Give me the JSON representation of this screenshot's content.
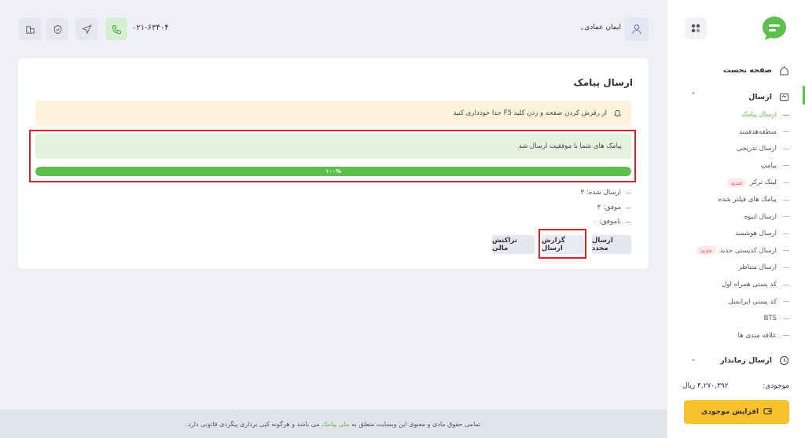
{
  "header": {
    "phone": "۰۲۱-۶۳۴۰۴",
    "user_name": "ایمان عمادی"
  },
  "sidebar": {
    "home": "صفحه نخست",
    "send_group": "ارسال",
    "sub_items": [
      {
        "label": "ارسال پیامک",
        "active": true
      },
      {
        "label": "منطقه‌هدفمند"
      },
      {
        "label": "ارسال تدریجی"
      },
      {
        "label": "پیامپ"
      },
      {
        "label": "لینک ترکر",
        "badge": "جدید"
      },
      {
        "label": "پیامک های فیلتر شده"
      },
      {
        "label": "ارسال انبوه"
      },
      {
        "label": "ارسال هوشمند"
      },
      {
        "label": "ارسال کدپستی جدید",
        "badge": "جدید"
      },
      {
        "label": "ارسال متناظر"
      },
      {
        "label": "کد پستی همراه اول"
      },
      {
        "label": "کد پستی ایرانسل"
      },
      {
        "label": "BTS"
      },
      {
        "label": "علاقه مندی ها"
      }
    ],
    "scheduled": "ارسال زماندار",
    "balance_label": "موجودی:",
    "balance_value": "۴,۲۷۰,۳۹۲ ریال",
    "topup_label": "افزایش موجودی"
  },
  "main": {
    "title": "ارسال پیامک",
    "warning": "از رفرش کردن صفحه و زدن کلید F5 جدا خودداری کنید",
    "success": "پیامک های شما با موفقیت ارسال شد",
    "progress_label": "۱۰۰%",
    "progress_value": 100,
    "stats": {
      "sent": "ارسال شده:",
      "sent_value": "۳",
      "ok": "موفق:",
      "ok_value": "۳",
      "fail": "ناموفق:",
      "fail_value": "۰"
    },
    "buttons": {
      "resend": "ارسال مجدد",
      "report": "گزارش ارسال",
      "transactions": "تراکنش مالی"
    }
  },
  "footer": {
    "text_before": "تمامی حقوق مادی و معنوی این وبسایت متعلق به",
    "link": "ملی پیامک",
    "text_after": "می باشد و هرگونه کپی برداری پیگردی قانونی دارد."
  },
  "colors": {
    "accent": "#5fbf4d",
    "warning_bg": "#fdf3da",
    "success_bg": "#e3f3df",
    "topup": "#f9c12e",
    "highlight": "#e32020"
  }
}
